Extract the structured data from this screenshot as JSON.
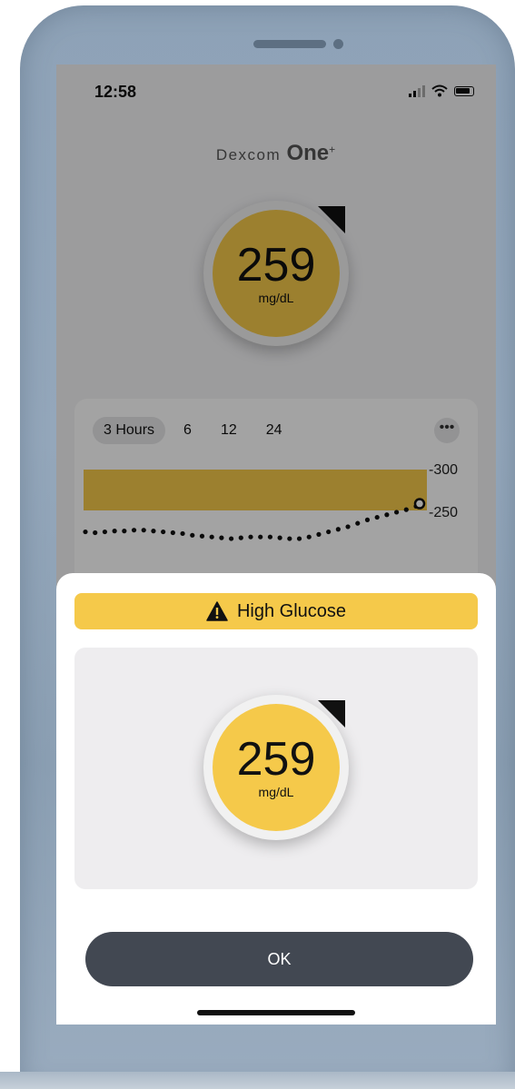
{
  "status_bar": {
    "time": "12:58"
  },
  "app": {
    "logo": {
      "wordmark": "Dexcom",
      "one": "One",
      "plus": "+"
    }
  },
  "glucose": {
    "value": "259",
    "unit": "mg/dL",
    "trend": "rising-arrow-icon"
  },
  "chart_card": {
    "tabs": [
      {
        "label": "3 Hours",
        "active": true
      },
      {
        "label": "6",
        "active": false
      },
      {
        "label": "12",
        "active": false
      },
      {
        "label": "24",
        "active": false
      }
    ],
    "more_label": "•••"
  },
  "chart_data": {
    "type": "scatter",
    "y_ticks": [
      "300",
      "250"
    ],
    "ylim": [
      200,
      310
    ],
    "high_band": [
      250,
      300
    ],
    "series": [
      {
        "values": [
          226,
          225,
          226,
          227,
          227,
          228,
          228,
          227,
          226,
          225,
          224,
          222,
          221,
          220,
          219,
          218,
          219,
          220,
          220,
          220,
          219,
          218,
          218,
          220,
          223,
          226,
          229,
          232,
          236,
          240,
          243,
          246,
          249,
          252,
          256
        ]
      }
    ],
    "current_value": 259
  },
  "alert": {
    "title": "High Glucose",
    "ok_label": "OK"
  },
  "colors": {
    "glucose_high": "#f5c94a",
    "button_dark": "#424852",
    "high_band": "#f5c94a"
  }
}
